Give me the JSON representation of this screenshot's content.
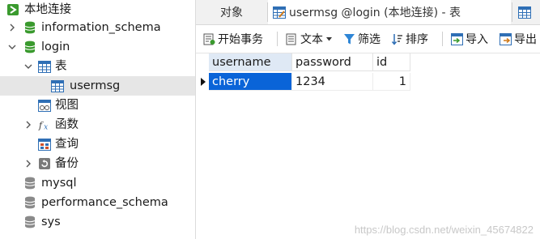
{
  "tree": {
    "connection": "本地连接",
    "databases": [
      {
        "name": "information_schema"
      },
      {
        "name": "login"
      },
      {
        "name": "mysql"
      },
      {
        "name": "performance_schema"
      },
      {
        "name": "sys"
      }
    ],
    "login_children": {
      "tables_label": "表",
      "table_item": "usermsg",
      "views_label": "视图",
      "functions_label": "函数",
      "queries_label": "查询",
      "backups_label": "备份"
    }
  },
  "tabs": {
    "objects": "对象",
    "active_tab": "usermsg @login (本地连接) - 表"
  },
  "toolbar": {
    "begin_transaction": "开始事务",
    "text": "文本",
    "filter": "筛选",
    "sort": "排序",
    "import": "导入",
    "export": "导出"
  },
  "table": {
    "columns": [
      "username",
      "password",
      "id"
    ],
    "rows": [
      [
        "cherry",
        "1234",
        "1"
      ]
    ]
  },
  "watermark": "https://blog.csdn.net/weixin_45674822",
  "colors": {
    "db_icon": "#3a9a2e",
    "selection": "#0a64d8",
    "table_icon": "#2f6fb5"
  }
}
